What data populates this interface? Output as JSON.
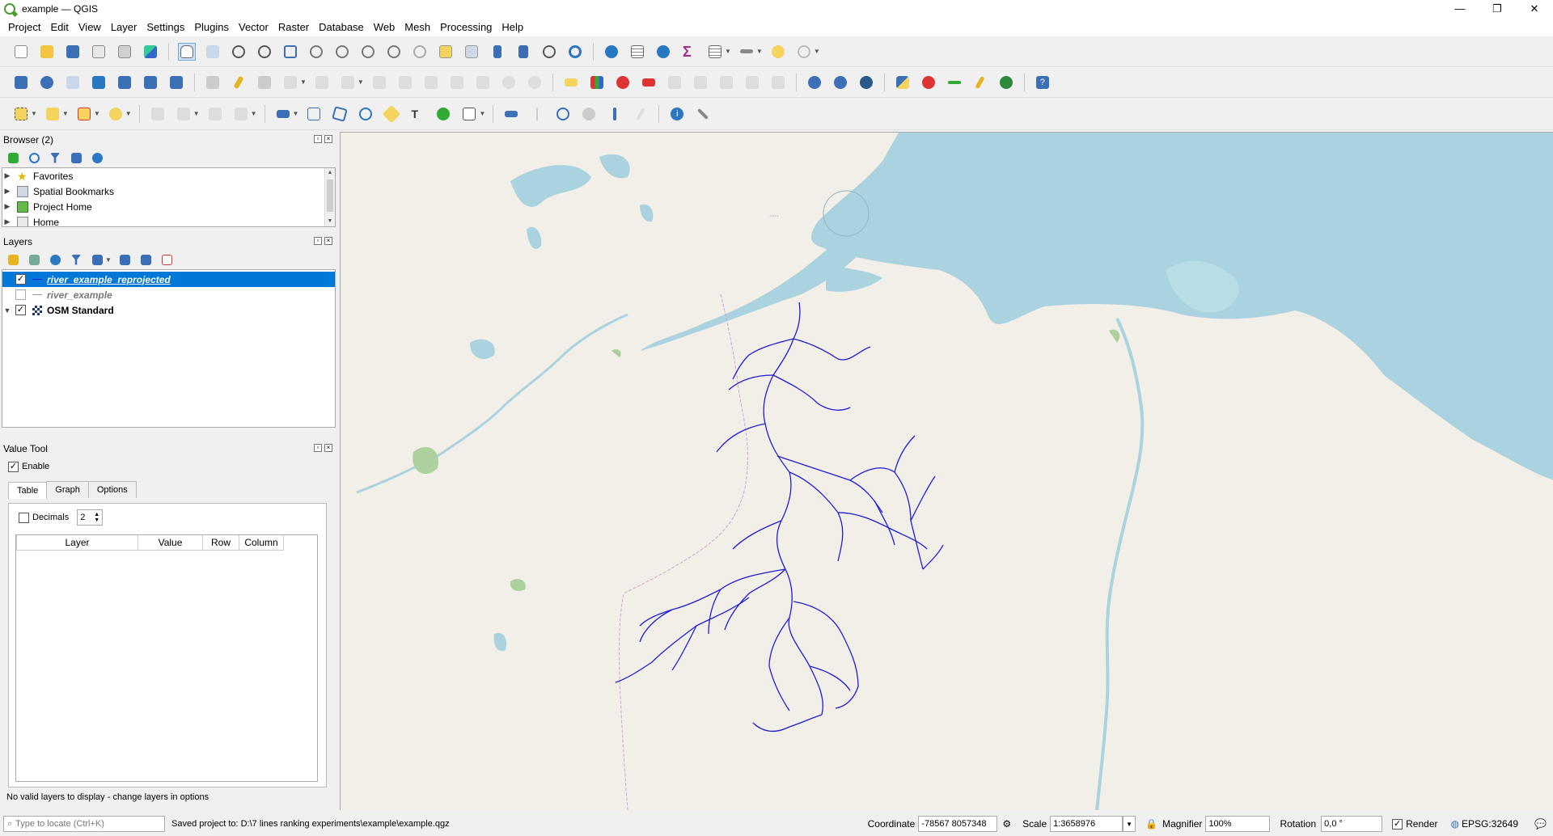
{
  "window": {
    "title": "example — QGIS",
    "controls": {
      "minimize": "—",
      "maximize": "❐",
      "close": "✕"
    }
  },
  "menu": [
    "Project",
    "Edit",
    "View",
    "Layer",
    "Settings",
    "Plugins",
    "Vector",
    "Raster",
    "Database",
    "Web",
    "Mesh",
    "Processing",
    "Help"
  ],
  "browser": {
    "title": "Browser (2)",
    "items": [
      {
        "label": "Favorites",
        "icon": "star-icon"
      },
      {
        "label": "Spatial Bookmarks",
        "icon": "bookmark-icon"
      },
      {
        "label": "Project Home",
        "icon": "project-home-icon"
      },
      {
        "label": "Home",
        "icon": "home-folder-icon"
      }
    ]
  },
  "layers": {
    "title": "Layers",
    "items": [
      {
        "label": "river_example_reprojected",
        "checked": true,
        "selected": true
      },
      {
        "label": "river_example",
        "checked": false,
        "selected": false
      },
      {
        "label": "OSM Standard",
        "checked": true,
        "selected": false
      }
    ]
  },
  "value_tool": {
    "title": "Value Tool",
    "enable_label": "Enable",
    "tabs": [
      "Table",
      "Graph",
      "Options"
    ],
    "active_tab": "Table",
    "decimals_label": "Decimals",
    "decimals_value": "2",
    "columns": [
      "Layer",
      "Value",
      "Row",
      "Column"
    ],
    "message": "No valid layers to display - change layers in options"
  },
  "status": {
    "locator_placeholder": "Type to locate (Ctrl+K)",
    "message": "Saved project to: D:\\7 lines ranking experiments\\example\\example.qgz",
    "coordinate_label": "Coordinate",
    "coordinate_value": "-78567 8057348",
    "scale_label": "Scale",
    "scale_value": "1:3658976",
    "magnifier_label": "Magnifier",
    "magnifier_value": "100%",
    "rotation_label": "Rotation",
    "rotation_value": "0,0 °",
    "render_label": "Render",
    "crs": "EPSG:32649"
  },
  "colors": {
    "selection": "#0078d7",
    "water": "#aad3df",
    "land": "#f2efe9",
    "river": "#1d1dd8",
    "vegetation": "#add19e"
  }
}
